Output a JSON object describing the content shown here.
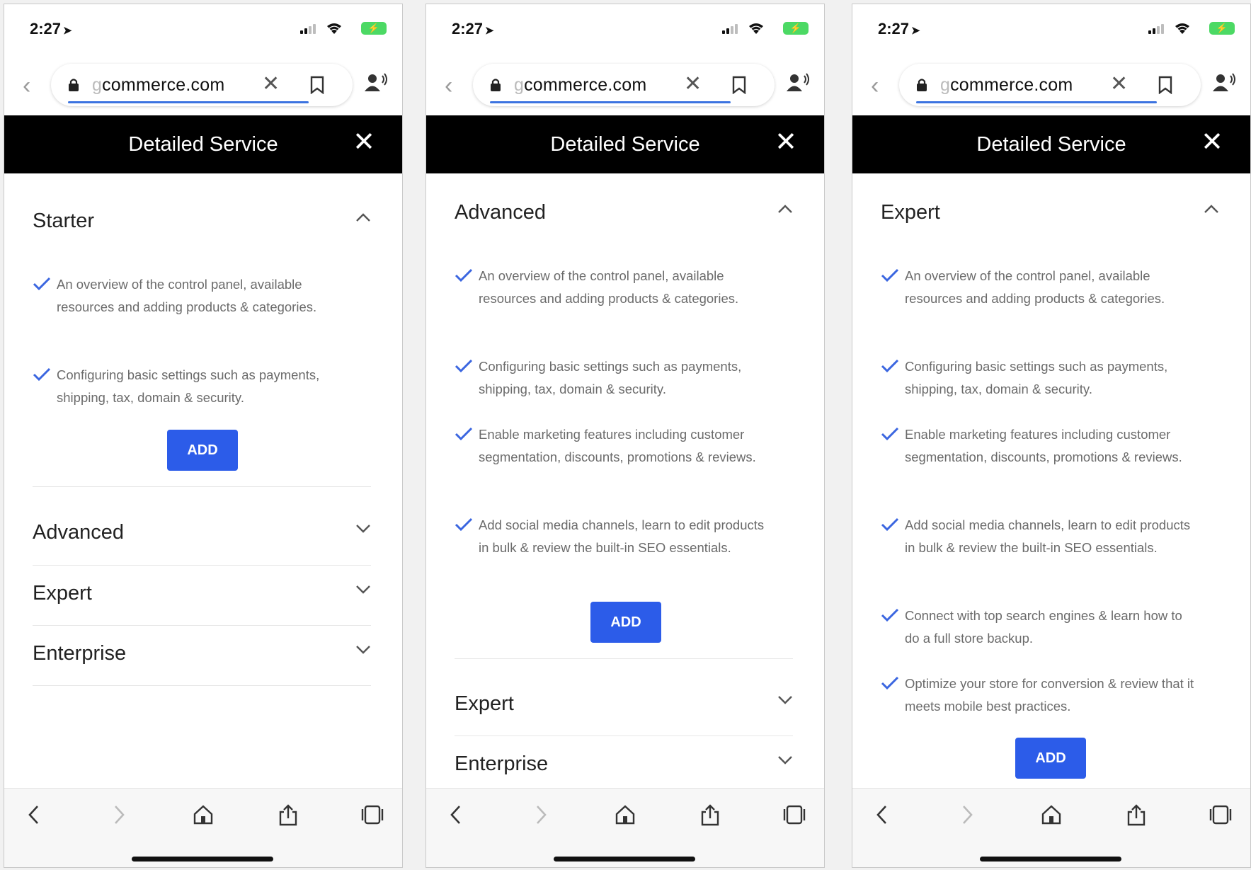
{
  "status": {
    "time": "2:27",
    "battery_glyph": "⚡",
    "icons": [
      "location-arrow-icon",
      "signal-icon",
      "wifi-icon",
      "battery-charging-icon"
    ]
  },
  "browser": {
    "url_faded": "g",
    "url_main": "commerce.com",
    "icons": [
      "back-chevron-icon",
      "lock-icon",
      "clear-x-icon",
      "bookmark-icon",
      "person-audio-icon"
    ]
  },
  "modal": {
    "title": "Detailed Service"
  },
  "features": [
    "An overview of the control panel, available resources and adding products & categories.",
    "Configuring basic settings such as payments, shipping, tax, domain & security.",
    "Enable marketing features including customer segmentation, discounts, promotions & reviews.",
    "Add social media channels, learn to edit products in bulk & review the built-in SEO essentials.",
    "Connect with top search engines & learn how to do a full store backup.",
    "Optimize your store for conversion & review that it meets mobile best practices."
  ],
  "add_label": "ADD",
  "tiers": {
    "starter": "Starter",
    "advanced": "Advanced",
    "expert": "Expert",
    "enterprise": "Enterprise"
  },
  "bottom_toolbar": {
    "icons": [
      "back-icon",
      "forward-icon",
      "home-icon",
      "share-icon",
      "tabs-icon"
    ]
  },
  "colors": {
    "accent": "#2c5ce9",
    "header_bg": "#000000",
    "check": "#3b66e0"
  }
}
